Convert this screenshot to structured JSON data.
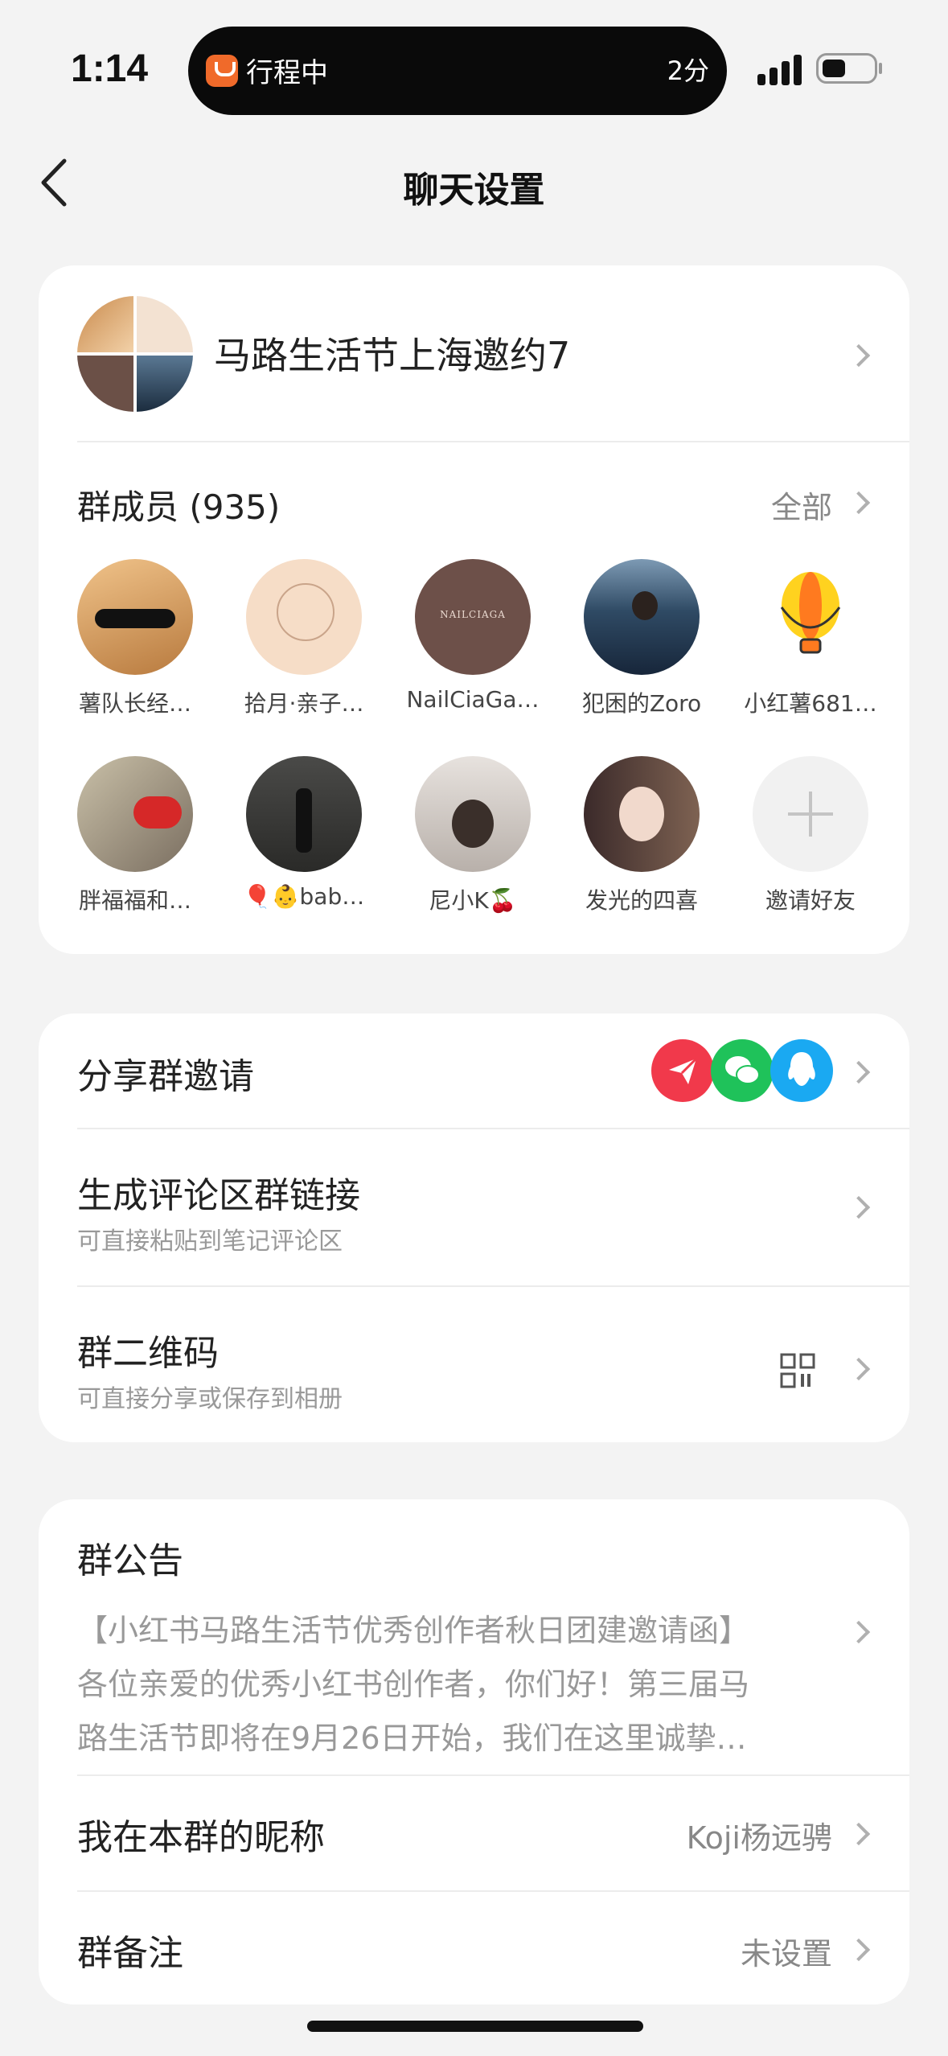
{
  "status": {
    "time": "1:14",
    "activity_text": "行程中",
    "activity_time": "2分"
  },
  "nav": {
    "title": "聊天设置"
  },
  "group": {
    "name": "马路生活节上海邀约7"
  },
  "members": {
    "label": "群成员 (935)",
    "all_label": "全部",
    "list": [
      {
        "name": "薯队长经…"
      },
      {
        "name": "拾月·亲子…"
      },
      {
        "name": "NailCiaGa…"
      },
      {
        "name": "犯困的Zoro"
      },
      {
        "name": "小红薯681…"
      },
      {
        "name": "胖福福和…"
      },
      {
        "name": "🎈👶bab…"
      },
      {
        "name": "尼小K🍒"
      },
      {
        "name": "发光的四喜"
      }
    ],
    "invite_label": "邀请好友",
    "logo_text": "NAILCIAGA"
  },
  "share": {
    "share_invite": "分享群邀请",
    "comment_link_title": "生成评论区群链接",
    "comment_link_sub": "可直接粘贴到笔记评论区",
    "qr_title": "群二维码",
    "qr_sub": "可直接分享或保存到相册",
    "icons": [
      "send-icon",
      "wechat-icon",
      "qq-icon"
    ],
    "colors": {
      "send": "#f1394b",
      "wechat": "#1fc25a",
      "qq": "#1aa9f2"
    }
  },
  "notice": {
    "title": "群公告",
    "lines": [
      "【小红书马路生活节优秀创作者秋日团建邀请函】",
      "各位亲爱的优秀小红书创作者，你们好！第三届马",
      "路生活节即将在9月26日开始，我们在这里诚挚…"
    ]
  },
  "nickname": {
    "label": "我在本群的昵称",
    "value": "Koji杨远骋"
  },
  "remark": {
    "label": "群备注",
    "value": "未设置"
  }
}
